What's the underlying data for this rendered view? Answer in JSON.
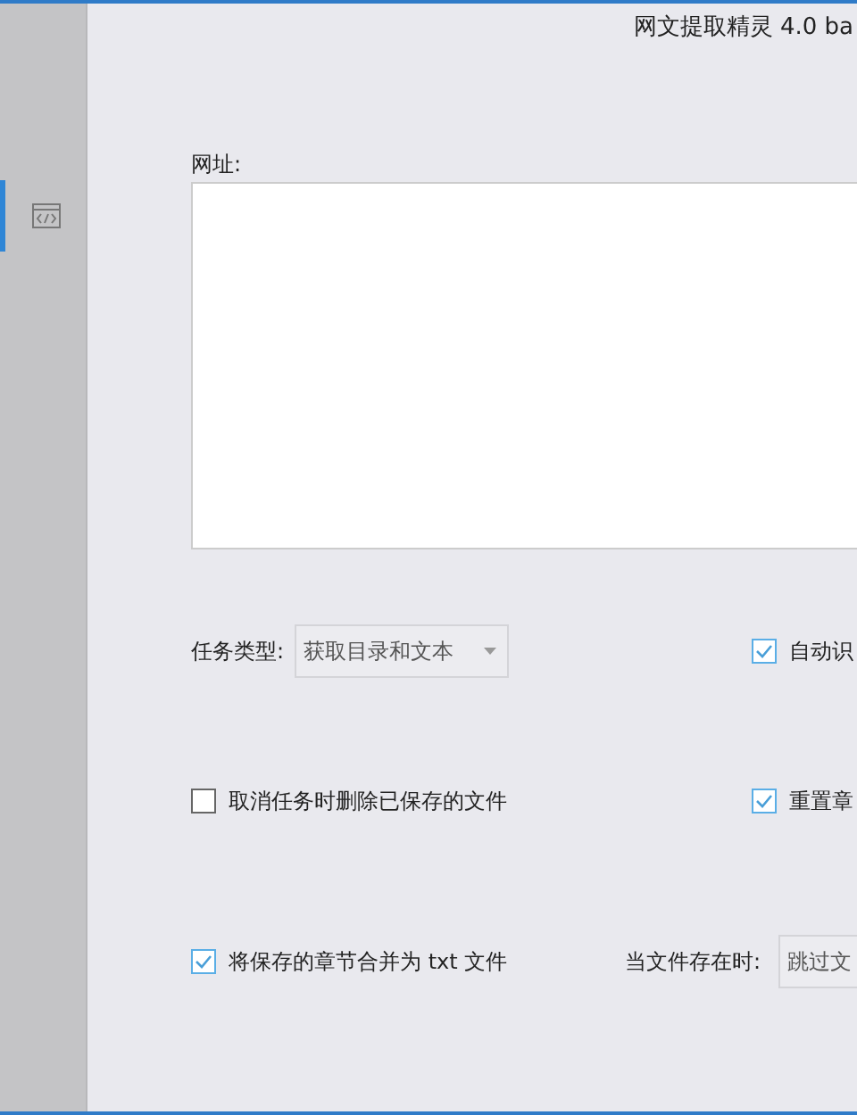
{
  "window": {
    "title": "网文提取精灵 4.0 ba"
  },
  "sidebar": {
    "items": [
      {
        "kind": "code",
        "selected": true
      }
    ]
  },
  "url_field": {
    "label": "网址:"
  },
  "task_type": {
    "label": "任务类型:",
    "value": "获取目录和文本"
  },
  "options": [
    {
      "label": "自动识",
      "checked": true
    },
    {
      "label": "取消任务时删除已保存的文件",
      "checked": false
    },
    {
      "label": "重置章",
      "checked": true
    },
    {
      "label": "将保存的章节合并为 txt 文件",
      "checked": true
    }
  ],
  "file_exists": {
    "label": "当文件存在时:",
    "value": "跳过文"
  }
}
